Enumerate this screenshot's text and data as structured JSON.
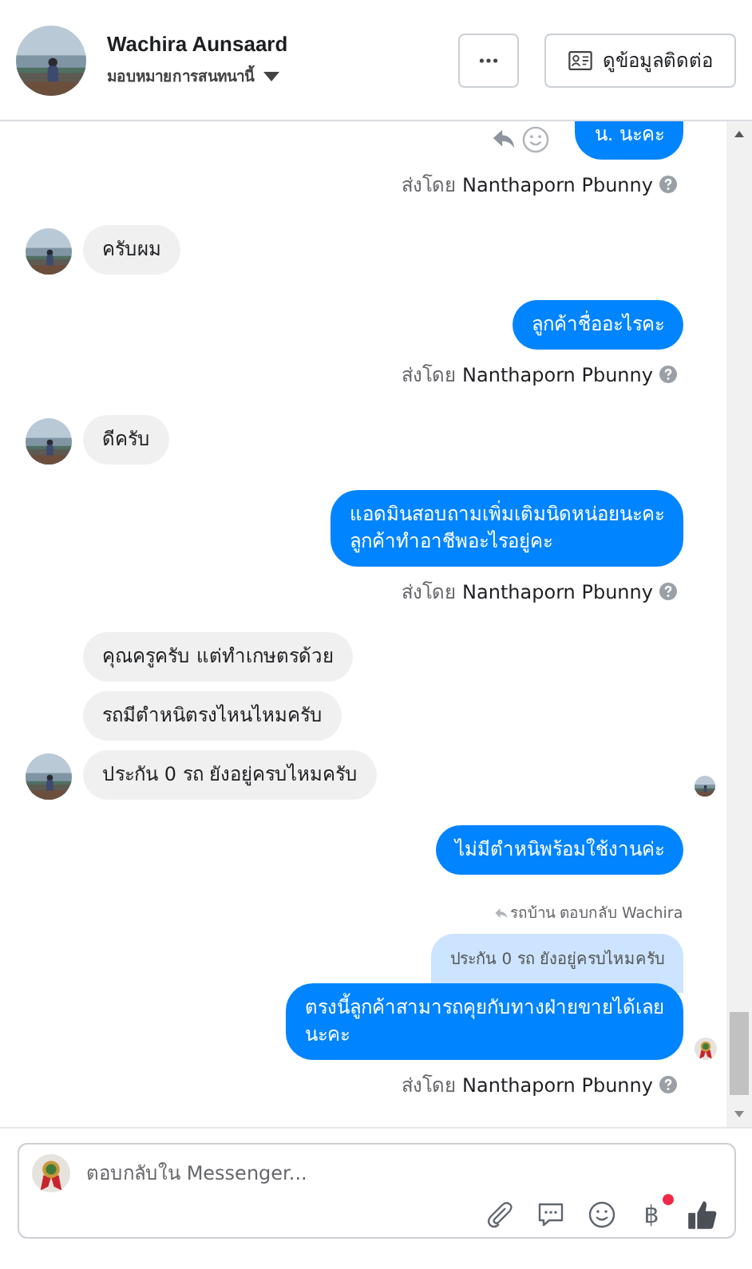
{
  "header": {
    "name": "Wachira Aunsaard",
    "subtitle": "มอบหมายการสนทนานี้",
    "contact_button": "ดูข้อมูลติดต่อ"
  },
  "messages": [
    {
      "kind": "out",
      "text": "น. นะคะ",
      "actions": true
    },
    {
      "kind": "sent_by",
      "label": "ส่งโดย",
      "sender": "Nanthaporn Pbunny"
    },
    {
      "kind": "in",
      "text": "ครับผม",
      "avatar": true
    },
    {
      "kind": "out",
      "text": "ลูกค้าชื่ออะไรคะ"
    },
    {
      "kind": "sent_by",
      "label": "ส่งโดย",
      "sender": "Nanthaporn Pbunny"
    },
    {
      "kind": "in",
      "text": "ดีครับ",
      "avatar": true
    },
    {
      "kind": "out",
      "text": "แอดมินสอบถามเพิ่มเติมนิดหน่อยนะคะ\nลูกค้าทำอาชีพอะไรอยู่คะ"
    },
    {
      "kind": "sent_by",
      "label": "ส่งโดย",
      "sender": "Nanthaporn Pbunny"
    },
    {
      "kind": "in",
      "text": "คุณครูครับ แต่ทำเกษตรด้วย",
      "avatar": false
    },
    {
      "kind": "in",
      "text": "รถมีตำหนิตรงไหนไหมครับ",
      "avatar": false
    },
    {
      "kind": "in",
      "text": "ประกัน 0 รถ ยังอยู่ครบไหมครับ",
      "avatar": true,
      "seen": true
    },
    {
      "kind": "out",
      "text": "ไม่มีตำหนิพร้อมใช้งานค่ะ"
    },
    {
      "kind": "reply_quote",
      "label": "รถบ้าน ตอบกลับ Wachira",
      "text": "ประกัน 0 รถ ยังอยู่ครบไหมครับ"
    },
    {
      "kind": "out",
      "text": "ตรงนี้ลูกค้าสามารถคุยกับทางฝ่ายขายได้เลย\nนะคะ",
      "page_avatar": true
    },
    {
      "kind": "sent_by",
      "label": "ส่งโดย",
      "sender": "Nanthaporn Pbunny"
    }
  ],
  "composer": {
    "placeholder": "ตอบกลับใน Messenger...",
    "currency_symbol": "฿",
    "payment_badge": true
  }
}
